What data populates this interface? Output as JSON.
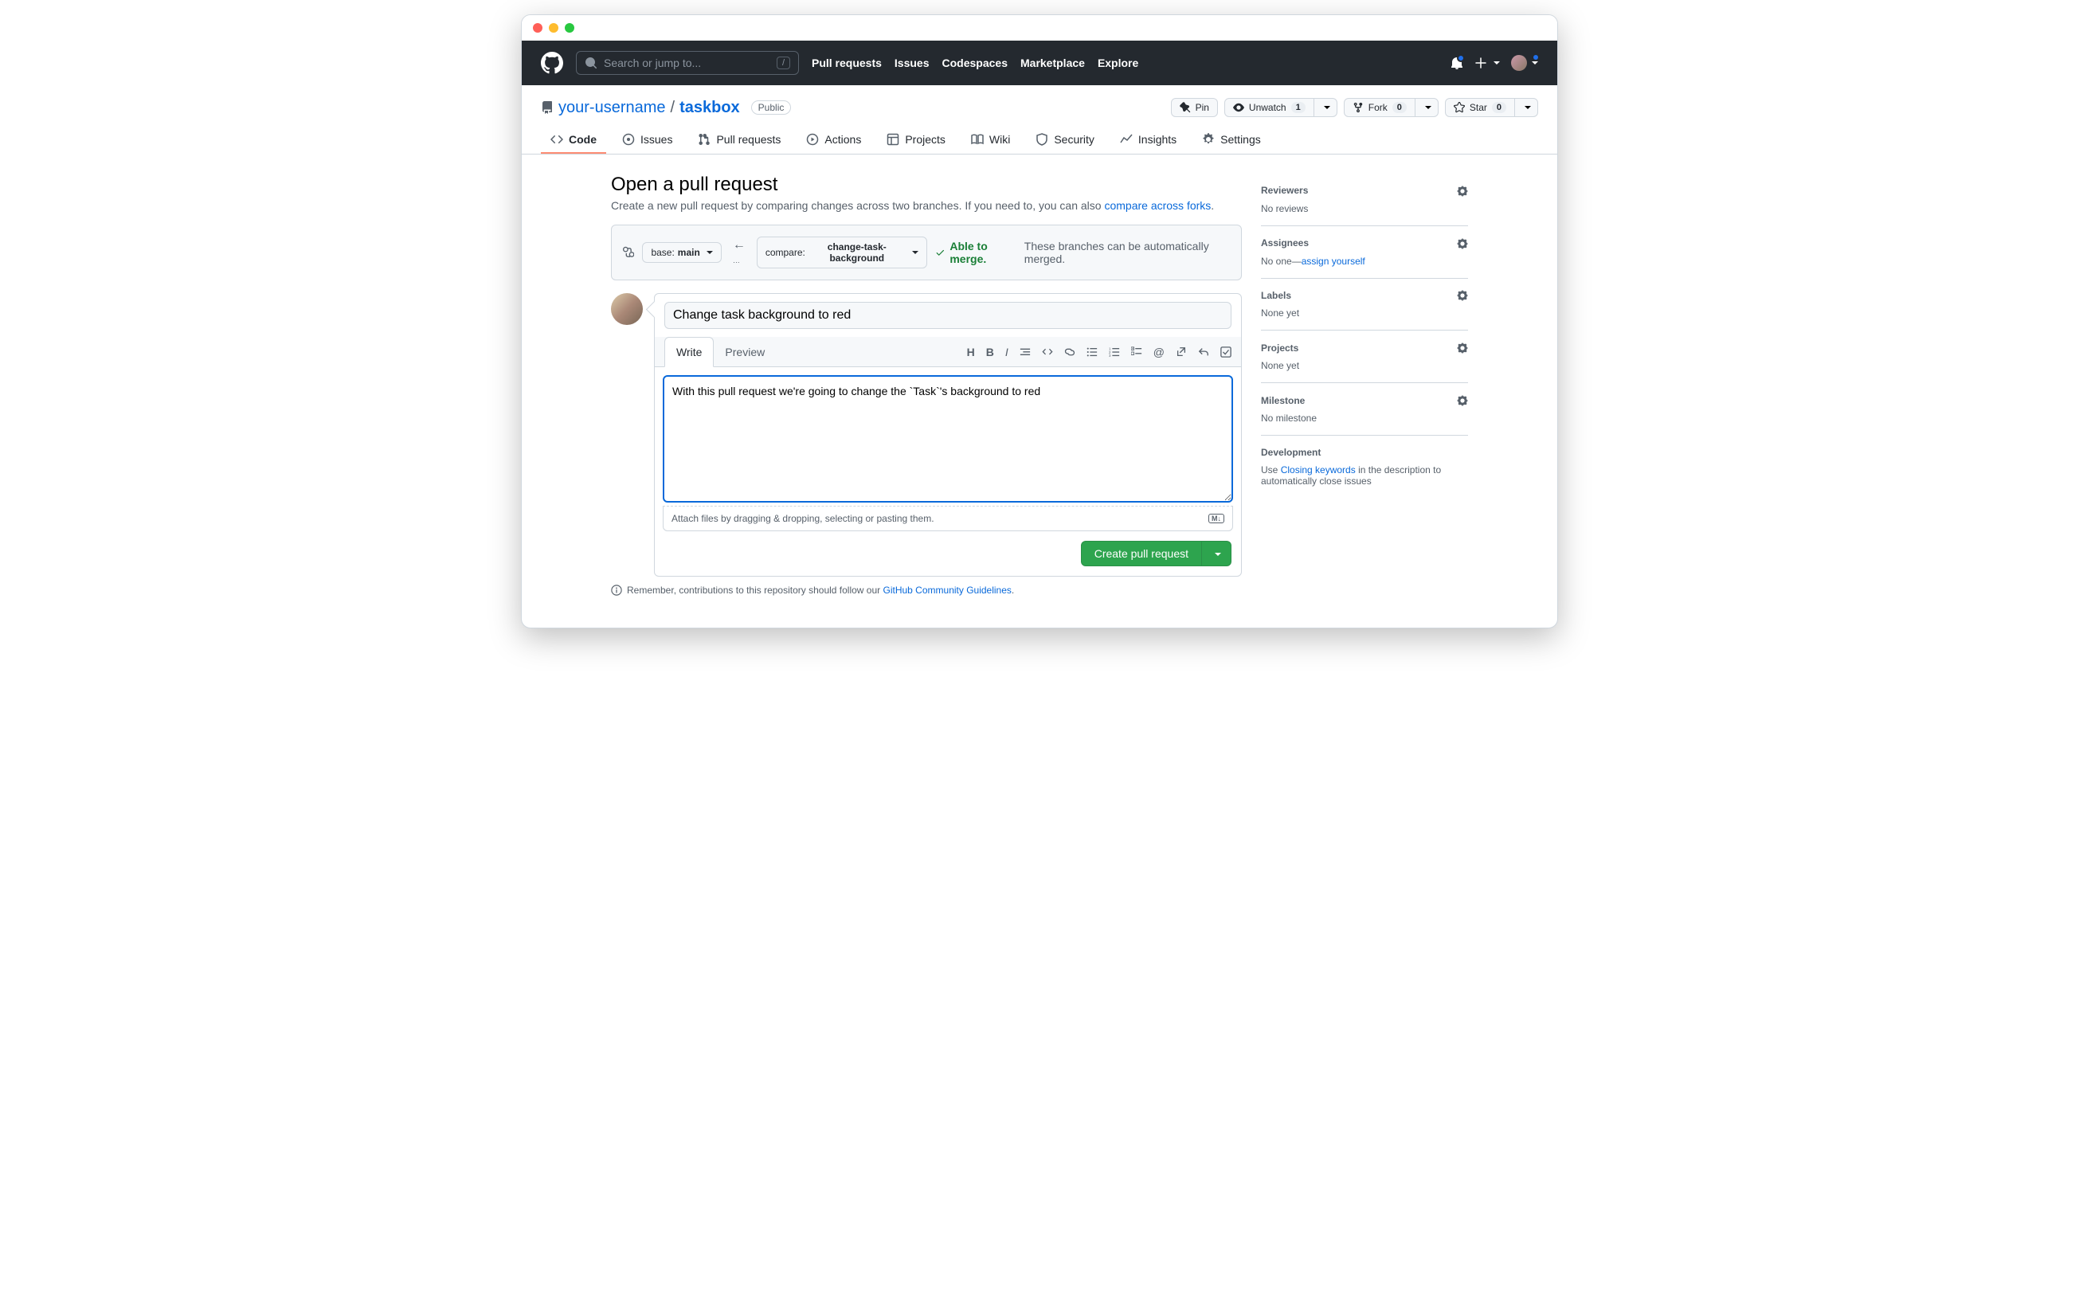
{
  "search": {
    "placeholder": "Search or jump to...",
    "shortcut": "/"
  },
  "nav": {
    "pull_requests": "Pull requests",
    "issues": "Issues",
    "codespaces": "Codespaces",
    "marketplace": "Marketplace",
    "explore": "Explore"
  },
  "repo": {
    "owner": "your-username",
    "name": "taskbox",
    "visibility": "Public"
  },
  "repo_actions": {
    "pin": "Pin",
    "unwatch": "Unwatch",
    "unwatch_count": "1",
    "fork": "Fork",
    "fork_count": "0",
    "star": "Star",
    "star_count": "0"
  },
  "tabs": {
    "code": "Code",
    "issues": "Issues",
    "pull_requests": "Pull requests",
    "actions": "Actions",
    "projects": "Projects",
    "wiki": "Wiki",
    "security": "Security",
    "insights": "Insights",
    "settings": "Settings"
  },
  "page": {
    "title": "Open a pull request",
    "subtitle_pre": "Create a new pull request by comparing changes across two branches. If you need to, you can also ",
    "subtitle_link": "compare across forks",
    "subtitle_post": "."
  },
  "compare": {
    "base_label": "base: ",
    "base_branch": "main",
    "compare_label": "compare: ",
    "compare_branch": "change-task-background",
    "merge_ok": "Able to merge.",
    "merge_msg": "These branches can be automatically merged."
  },
  "form": {
    "title_value": "Change task background to red",
    "write_tab": "Write",
    "preview_tab": "Preview",
    "body_value": "With this pull request we're going to change the `Task`'s background to red",
    "attach_hint": "Attach files by dragging & dropping, selecting or pasting them.",
    "submit": "Create pull request"
  },
  "footnote": {
    "pre": "Remember, contributions to this repository should follow our ",
    "link": "GitHub Community Guidelines",
    "post": "."
  },
  "sidebar": {
    "reviewers": {
      "title": "Reviewers",
      "value": "No reviews"
    },
    "assignees": {
      "title": "Assignees",
      "value_pre": "No one—",
      "assign_self": "assign yourself"
    },
    "labels": {
      "title": "Labels",
      "value": "None yet"
    },
    "projects": {
      "title": "Projects",
      "value": "None yet"
    },
    "milestone": {
      "title": "Milestone",
      "value": "No milestone"
    },
    "development": {
      "title": "Development",
      "pre": "Use ",
      "link": "Closing keywords",
      "post": " in the description to automatically close issues"
    }
  }
}
